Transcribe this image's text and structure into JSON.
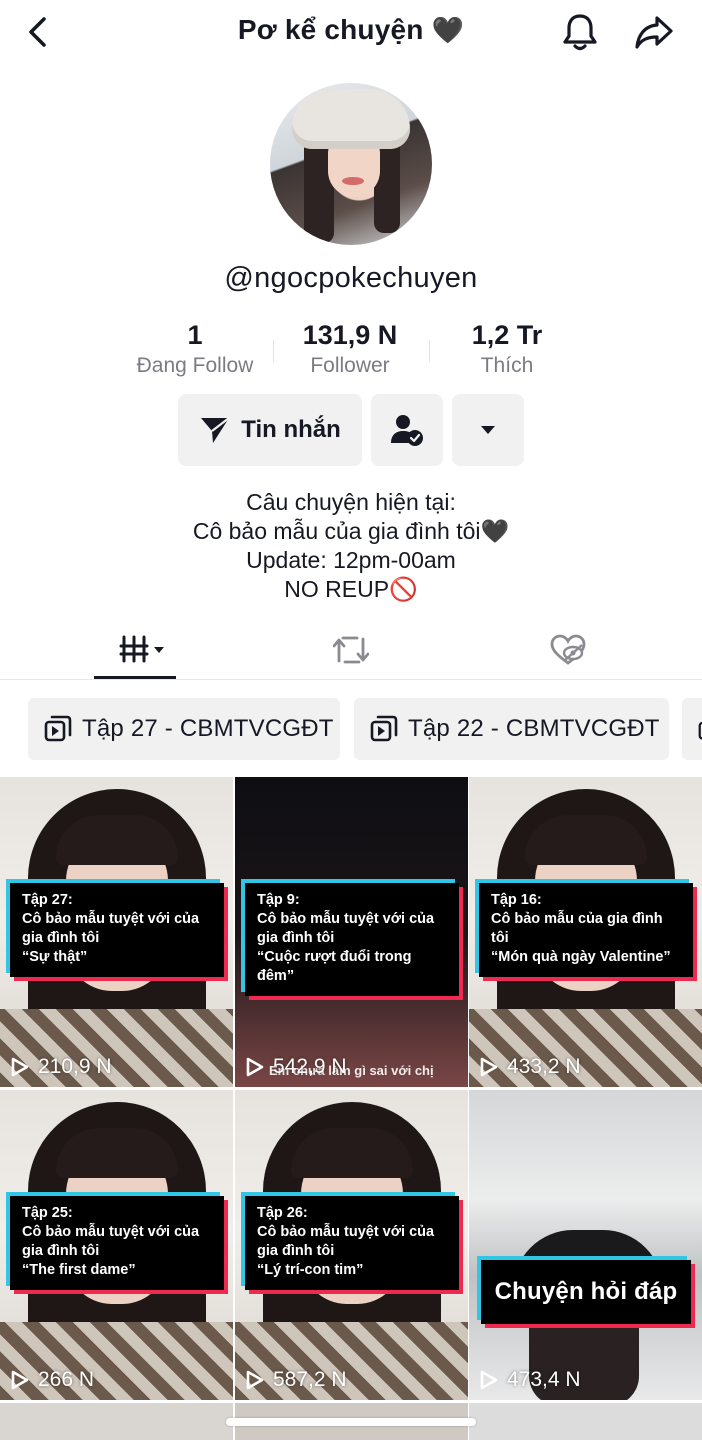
{
  "header": {
    "title": "Pơ kể chuyện",
    "title_emoji": "🖤"
  },
  "profile": {
    "username": "@ngocpokechuyen"
  },
  "stats": [
    {
      "value": "1",
      "label": "Đang Follow"
    },
    {
      "value": "131,9 N",
      "label": "Follower"
    },
    {
      "value": "1,2 Tr",
      "label": "Thích"
    }
  ],
  "actions": {
    "message_label": "Tin nhắn"
  },
  "bio": [
    "Câu chuyện hiện tại:",
    "Cô bảo mẫu của gia đình tôi🖤",
    "Update: 12pm-00am",
    "NO REUP🚫"
  ],
  "tabs": [
    "videos-tab",
    "reposts-tab",
    "liked-tab"
  ],
  "playlists": [
    {
      "label": "Tập 27 - CBMTVCGĐT"
    },
    {
      "label": "Tập 22 - CBMTVCGĐT"
    }
  ],
  "videos": [
    {
      "caption": [
        "Tập 27:",
        "Cô bảo mẫu tuyệt với của",
        "gia đình tôi",
        "“Sự thật”"
      ],
      "views": "210,9 N"
    },
    {
      "caption": [
        "Tập 9:",
        "Cô bảo mẫu tuyệt với của",
        "gia đình tôi",
        "“Cuộc rượt đuổi trong",
        "đêm”"
      ],
      "views": "542,9 N",
      "subtitle": "Em chưa làm gì sai với chị"
    },
    {
      "caption": [
        "Tập 16:",
        "Cô bảo mẫu của gia đình",
        "tôi",
        "“Món quà ngày Valentine”"
      ],
      "views": "433,2 N"
    },
    {
      "caption": [
        "Tập 25:",
        "Cô bảo mẫu tuyệt với của",
        "gia đình tôi",
        "“The first dame”"
      ],
      "views": "266 N"
    },
    {
      "caption": [
        "Tập 26:",
        "Cô bảo mẫu tuyệt với của",
        "gia đình tôi",
        "“Lý trí-con tim”"
      ],
      "views": "587,2 N"
    },
    {
      "big_caption": "Chuyện hỏi đáp",
      "views": "473,4 N"
    }
  ],
  "colors": {
    "accent_cyan": "#31c6e6",
    "accent_red": "#ef2a50",
    "button_bg": "#f1f1f2"
  }
}
